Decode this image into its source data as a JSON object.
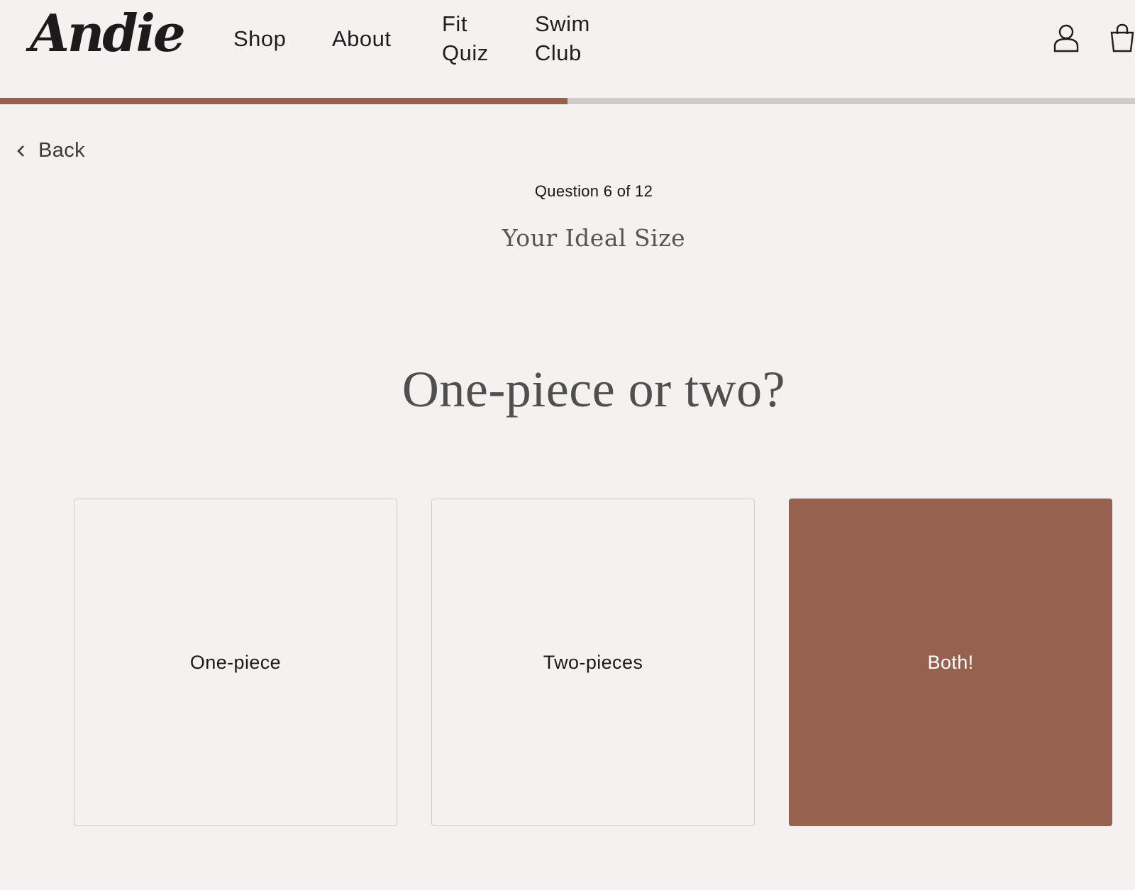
{
  "header": {
    "logo": "Andie",
    "nav": {
      "shop": "Shop",
      "about": "About",
      "fit_quiz_line1": "Fit",
      "fit_quiz_line2": "Quiz",
      "swim_club_line1": "Swim",
      "swim_club_line2": "Club"
    },
    "icons": {
      "account": "account-icon",
      "bag": "shopping-bag-icon"
    }
  },
  "progress": {
    "current": 6,
    "total": 12,
    "fill_color": "#96624f",
    "track_color": "#cfcccb"
  },
  "back": {
    "label": "Back",
    "icon": "chevron-left-icon"
  },
  "quiz": {
    "question_count": "Question 6 of 12",
    "section_title": "Your Ideal Size",
    "question": "One-piece or two?",
    "options": [
      {
        "label": "One-piece",
        "selected": false
      },
      {
        "label": "Two-pieces",
        "selected": false
      },
      {
        "label": "Both!",
        "selected": true
      }
    ]
  },
  "colors": {
    "background": "#f4f1f0",
    "accent": "#96624f",
    "text": "#1f1f1f"
  }
}
